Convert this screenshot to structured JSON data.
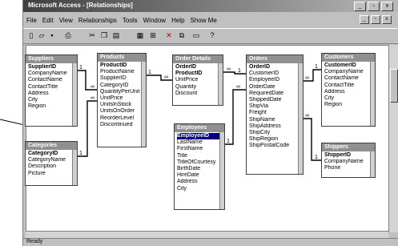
{
  "window": {
    "title": "Microsoft Access - [Relationships]"
  },
  "controls": {
    "minimize": "_",
    "maximize": "▫",
    "close": "x"
  },
  "menu": [
    "File",
    "Edit",
    "View",
    "Relationships",
    "Tools",
    "Window",
    "Help",
    "Show Me"
  ],
  "toolbar": {
    "icons": [
      "new-icon",
      "open-icon",
      "save-icon",
      "print-icon",
      "cut-icon",
      "copy-icon",
      "paste-icon",
      "show-table-icon",
      "show-relationships-icon",
      "delete-icon",
      "relationships-icon",
      "new-object-icon",
      "help-icon"
    ]
  },
  "tables": {
    "suppliers": {
      "title": "Suppliers",
      "fields": [
        "SupplierID",
        "CompanyName",
        "ContactName",
        "ContactTitle",
        "Address",
        "City",
        "Region"
      ]
    },
    "categories": {
      "title": "Categories",
      "fields": [
        "CategoryID",
        "CategoryName",
        "Description",
        "Picture"
      ]
    },
    "products": {
      "title": "Products",
      "fields": [
        "ProductID",
        "ProductName",
        "SupplierID",
        "CategoryID",
        "QuantityPerUnit",
        "UnitPrice",
        "UnitsInStock",
        "UnitsOnOrder",
        "ReorderLevel",
        "Discontinued"
      ]
    },
    "order_details": {
      "title": "Order Details",
      "fields": [
        "OrderID",
        "ProductID",
        "UnitPrice",
        "Quantity",
        "Discount"
      ]
    },
    "employees": {
      "title": "Employees",
      "fields": [
        "EmployeeID",
        "LastName",
        "FirstName",
        "Title",
        "TitleOfCourtesy",
        "BirthDate",
        "HireDate",
        "Address",
        "City"
      ]
    },
    "orders": {
      "title": "Orders",
      "fields": [
        "OrderID",
        "CustomerID",
        "EmployeeID",
        "OrderDate",
        "RequiredDate",
        "ShippedDate",
        "ShipVia",
        "Freight",
        "ShipName",
        "ShipAddress",
        "ShipCity",
        "ShipRegion",
        "ShipPostalCode"
      ]
    },
    "customers": {
      "title": "Customers",
      "fields": [
        "CustomerID",
        "CompanyName",
        "ContactName",
        "ContactTitle",
        "Address",
        "City",
        "Region"
      ]
    },
    "shippers": {
      "title": "Shippers",
      "fields": [
        "ShipperID",
        "CompanyName",
        "Phone"
      ]
    }
  },
  "relationship_labels": {
    "one": "1",
    "many": "∞"
  },
  "status": {
    "text": "Ready"
  }
}
